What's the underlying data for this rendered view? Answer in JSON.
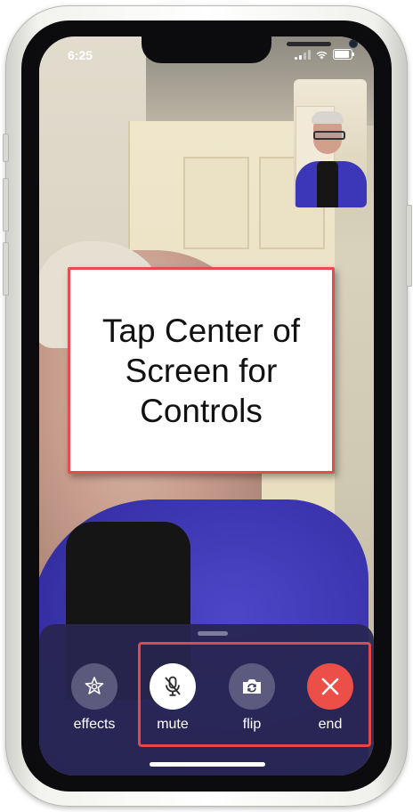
{
  "status_bar": {
    "time": "6:25"
  },
  "callout": {
    "lines": [
      "Tap Center of",
      "Screen for",
      "Controls"
    ]
  },
  "controls": [
    {
      "id": "effects",
      "label": "effects",
      "icon": "effects-star-icon"
    },
    {
      "id": "mute",
      "label": "mute",
      "icon": "microphone-slash-icon"
    },
    {
      "id": "flip",
      "label": "flip",
      "icon": "camera-flip-icon"
    },
    {
      "id": "end",
      "label": "end",
      "icon": "close-x-icon"
    }
  ],
  "colors": {
    "highlight": "#e0484c",
    "end_button": "#eb4f47",
    "tray": "#28264f",
    "mute_active": "#ffffff"
  }
}
